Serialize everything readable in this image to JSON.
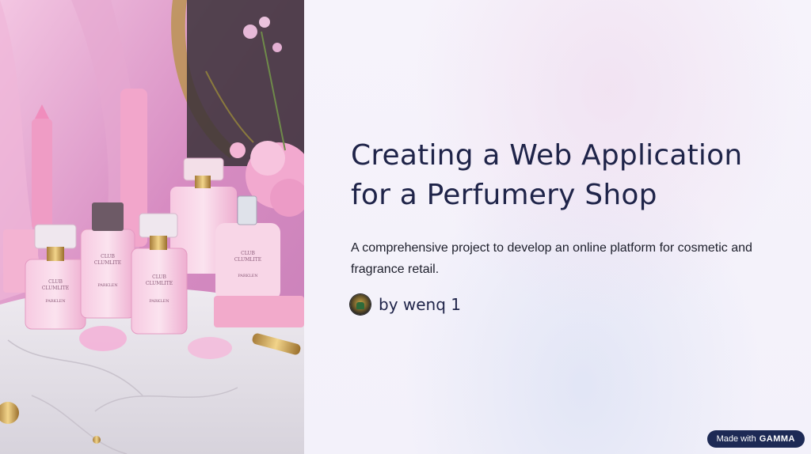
{
  "slide": {
    "title_line1": "Creating a Web Application",
    "title_line2": "for a Perfumery Shop",
    "subtitle": "A comprehensive project to develop an online platform for cosmetic and fragrance retail.",
    "author": "by wenq 1"
  },
  "image": {
    "bottle_label_1": "CLUB",
    "bottle_label_2": "CLUMLITE",
    "bottle_brand": "PARKLEN"
  },
  "badge": {
    "prefix": "Made with",
    "brand": "GAMMA"
  },
  "colors": {
    "title": "#1f2449",
    "badge_bg": "#1d2a55",
    "panel_bg": "#f5f2fb"
  },
  "icons": {
    "avatar": "author-avatar"
  }
}
